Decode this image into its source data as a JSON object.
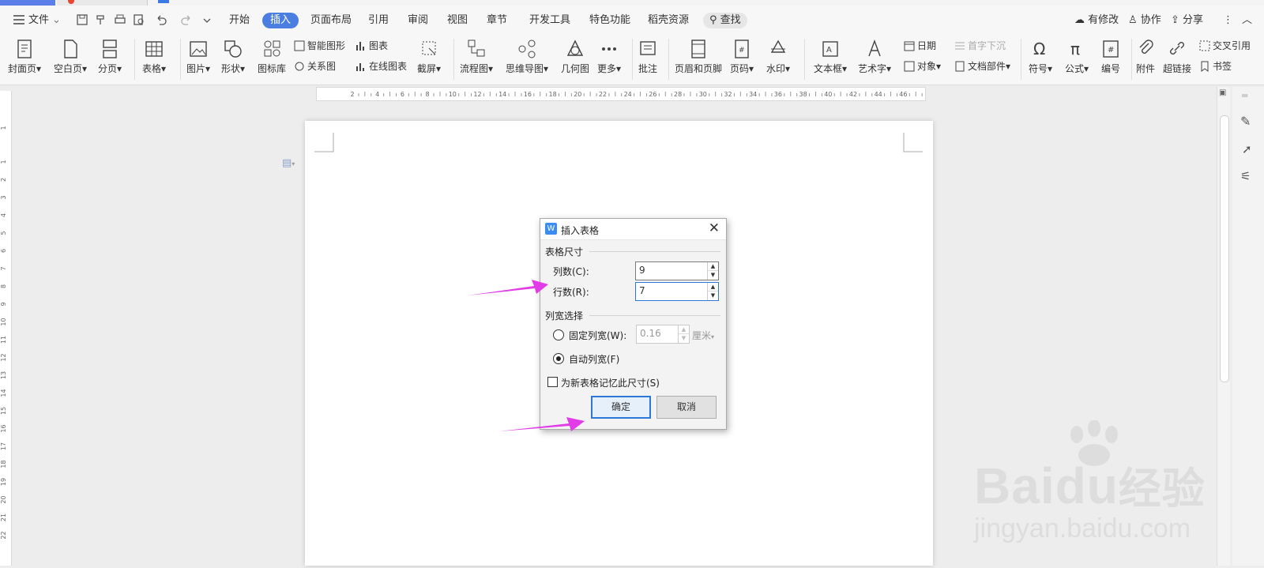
{
  "menubar": {
    "file_label": "文件",
    "tabs": [
      "开始",
      "插入",
      "页面布局",
      "引用",
      "审阅",
      "视图",
      "章节",
      "开发工具",
      "特色功能",
      "稻壳资源"
    ],
    "active_tab": "插入",
    "search_label": "查找",
    "right": {
      "modified": "有修改",
      "collab": "协作",
      "share": "分享"
    }
  },
  "ribbon": {
    "cover": "封面页",
    "blank": "空白页",
    "pagebreak": "分页",
    "table": "表格",
    "picture": "图片",
    "shape": "形状",
    "iconlib": "图标库",
    "smartart": "智能图形",
    "chart": "图表",
    "relation": "关系图",
    "onlinechart": "在线图表",
    "screenshot": "截屏",
    "flowchart": "流程图",
    "mindmap": "思维导图",
    "geometry": "几何图",
    "more": "更多",
    "comment": "批注",
    "headerfooter": "页眉和页脚",
    "pagenum": "页码",
    "watermark": "水印",
    "textbox": "文本框",
    "wordart": "艺术字",
    "date": "日期",
    "dropcap": "首字下沉",
    "object": "对象",
    "docpart": "文档部件",
    "symbol": "符号",
    "formula": "公式",
    "numbering": "编号",
    "attachment": "附件",
    "hyperlink": "超链接",
    "crossref": "交叉引用",
    "bookmark": "书签"
  },
  "ruler": {
    "h_ticks": [
      "2",
      "4",
      "6",
      "8",
      "10",
      "12",
      "14",
      "16",
      "18",
      "20",
      "22",
      "24",
      "26",
      "28",
      "30",
      "32",
      "34",
      "36",
      "38",
      "40",
      "42",
      "44",
      "46"
    ],
    "v_ticks": [
      "1",
      "1",
      "2",
      "3",
      "4",
      "5",
      "6",
      "7",
      "8",
      "9",
      "10",
      "11",
      "12",
      "13",
      "14",
      "15",
      "16",
      "17",
      "18",
      "19",
      "20",
      "21",
      "22"
    ]
  },
  "dialog": {
    "title": "插入表格",
    "size_group": "表格尺寸",
    "cols_label": "列数(C):",
    "cols_value": "9",
    "rows_label": "行数(R):",
    "rows_value": "7",
    "width_group": "列宽选择",
    "fixed_label": "固定列宽(W):",
    "fixed_value": "0.16",
    "fixed_unit": "厘米",
    "fixed_selected": false,
    "auto_label": "自动列宽(F)",
    "auto_selected": true,
    "remember_label": "为新表格记忆此尺寸(S)",
    "remember_checked": false,
    "ok_label": "确定",
    "cancel_label": "取消"
  },
  "watermark": {
    "brand": "Bai",
    "brand2": "du",
    "cn": "经验",
    "url": "jingyan.baidu.com"
  },
  "colors": {
    "accent": "#4a7ee0",
    "arrow": "#e23be8",
    "dialog_ok_border": "#2b78d8"
  }
}
